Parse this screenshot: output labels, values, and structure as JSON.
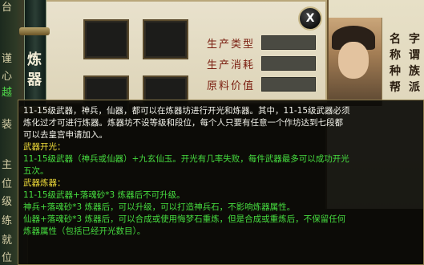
{
  "left_strip": {
    "items": [
      {
        "text": "台",
        "color": "light"
      },
      {
        "text": "谨",
        "color": "light"
      },
      {
        "text": "心",
        "color": "light"
      },
      {
        "text": "越",
        "color": "green"
      },
      {
        "text": "装",
        "color": "light"
      },
      {
        "text": "主",
        "color": "light"
      },
      {
        "text": "位",
        "color": "light"
      },
      {
        "text": "级",
        "color": "light"
      },
      {
        "text": "练",
        "color": "light"
      },
      {
        "text": "就",
        "color": "light"
      },
      {
        "text": "位",
        "color": "light"
      }
    ]
  },
  "forge": {
    "scroll_title": "炼",
    "scroll_title2": "器",
    "attributes": [
      {
        "label": "生产类型",
        "value": ""
      },
      {
        "label": "生产消耗",
        "value": ""
      },
      {
        "label": "原料价值",
        "value": ""
      }
    ],
    "close_label": "X"
  },
  "character": {
    "col_left": [
      "名",
      "称",
      "种",
      "帮"
    ],
    "col_right": [
      "字",
      "谓",
      "族",
      "派"
    ]
  },
  "tooltip": {
    "intro_1": "11-15级武器，神兵，仙器，都可以在炼器坊进行开光和炼器。其中，11-15级武器必须",
    "intro_2": "炼化过才可进行炼器。炼器坊不设等级和段位，每个人只要有任意一个作坊达到七段都",
    "intro_3": "可以去皇宫申请加入。",
    "kaiguang_title": "武器开光：",
    "kaiguang_1": "11-15级武器（神兵或仙器）+九玄仙玉。开光有几率失败，每件武器最多可以成功开光",
    "kaiguang_2": "五次。",
    "lianqi_title": "武器炼器：",
    "lianqi_1": "11-15级武器+落魂砂*3 炼器后不可升级。",
    "lianqi_2": "神兵+落魂砂*3 炼器后，可以升级，可以打造神兵石，不影响炼器属性。",
    "lianqi_3": "仙器+落魂砂*3 炼器后，可以合成或使用悔梦石重炼，但是合成或重炼后，不保留任何",
    "lianqi_4": "炼器属性（包括已经开光数目）。"
  }
}
